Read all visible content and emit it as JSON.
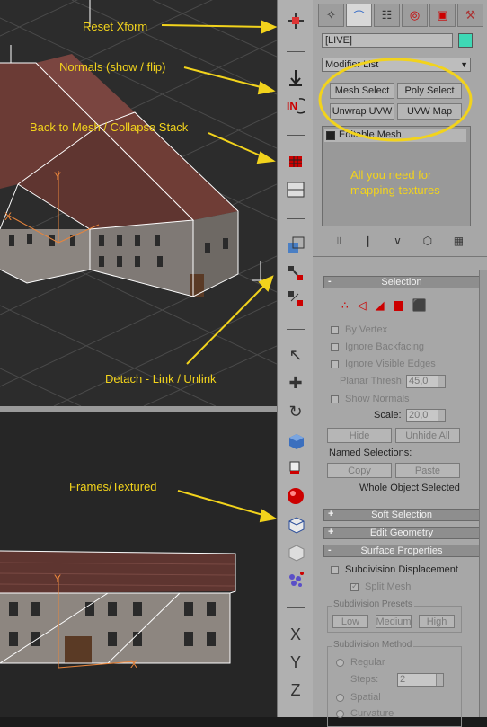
{
  "callouts": {
    "reset_xform": "Reset Xform",
    "normals": "Normals (show / flip)",
    "back_to_mesh": "Back to Mesh / Collapse Stack",
    "detach": "Detach - Link / Unlink",
    "frames": "Frames/Textured",
    "all_you_need_line1": "All you need for",
    "all_you_need_line2": "mapping textures"
  },
  "axis_letters": [
    "X",
    "Y",
    "Z"
  ],
  "command_panel": {
    "object_name": "[LIVE]",
    "modifier_list": "Modifier List",
    "buttons": {
      "mesh_select": "Mesh Select",
      "poly_select": "Poly Select",
      "unwrap_uvw": "Unwrap UVW",
      "uvw_map": "UVW Map"
    },
    "stack_item": "Editable Mesh"
  },
  "selection": {
    "header": "Selection",
    "by_vertex": "By Vertex",
    "ignore_backfacing": "Ignore Backfacing",
    "ignore_visible_edges": "Ignore Visible Edges",
    "planar_thresh_label": "Planar Thresh:",
    "planar_thresh_value": "45,0",
    "show_normals": "Show Normals",
    "scale_label": "Scale:",
    "scale_value": "20,0",
    "hide": "Hide",
    "unhide_all": "Unhide All",
    "named_selections": "Named Selections:",
    "copy": "Copy",
    "paste": "Paste",
    "status": "Whole Object Selected"
  },
  "rollouts": {
    "soft_selection": "Soft Selection",
    "edit_geometry": "Edit Geometry",
    "surface_properties": "Surface Properties"
  },
  "surface": {
    "subdivision_displacement": "Subdivision Displacement",
    "split_mesh": "Split Mesh",
    "presets_title": "Subdivision Presets",
    "low": "Low",
    "medium": "Medium",
    "high": "High",
    "method_title": "Subdivision Method",
    "regular": "Regular",
    "steps_label": "Steps:",
    "steps_value": "2",
    "spatial": "Spatial",
    "curvature": "Curvature"
  },
  "colors": {
    "callout": "#f2d31c",
    "swatch": "#3ed8b5",
    "panel_bg": "#a7a7a7",
    "highlight_circle": "#f2d31c"
  }
}
